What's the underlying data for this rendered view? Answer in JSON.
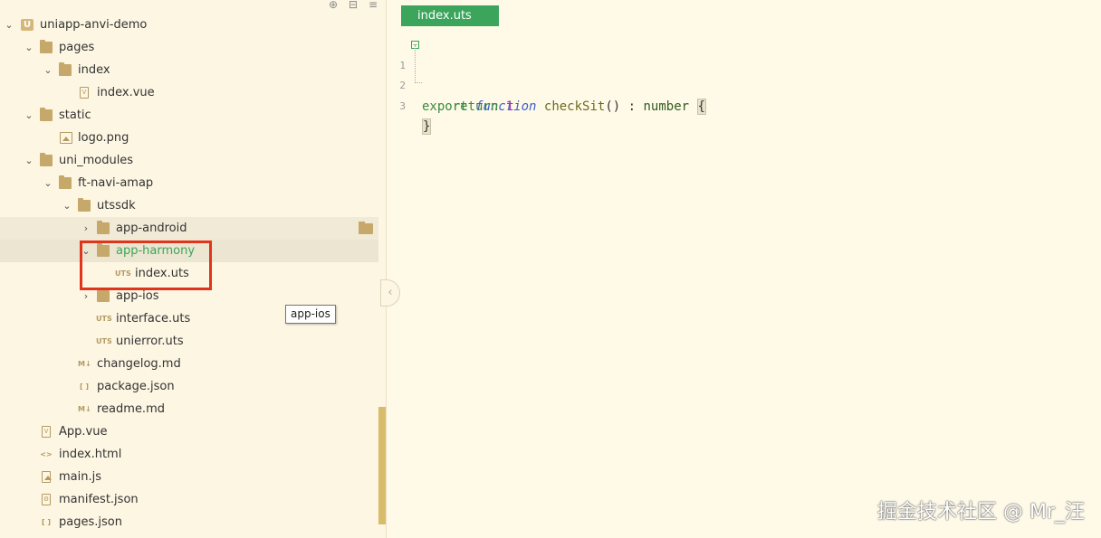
{
  "sidebar": {
    "tree": [
      {
        "label": "uniapp-anvi-demo",
        "icon": "project-icon",
        "expanded": true
      },
      {
        "label": "pages",
        "icon": "folder-icon",
        "expanded": true
      },
      {
        "label": "index",
        "icon": "folder-icon",
        "expanded": true
      },
      {
        "label": "index.vue",
        "icon": "vue-file-icon"
      },
      {
        "label": "static",
        "icon": "folder-icon",
        "expanded": true
      },
      {
        "label": "logo.png",
        "icon": "image-file-icon"
      },
      {
        "label": "uni_modules",
        "icon": "folder-icon",
        "expanded": true
      },
      {
        "label": "ft-navi-amap",
        "icon": "folder-icon",
        "expanded": true
      },
      {
        "label": "utssdk",
        "icon": "folder-icon",
        "expanded": true
      },
      {
        "label": "app-android",
        "icon": "folder-icon",
        "expanded": false
      },
      {
        "label": "app-harmony",
        "icon": "folder-icon",
        "expanded": true
      },
      {
        "label": "index.uts",
        "icon": "uts-file-icon"
      },
      {
        "label": "app-ios",
        "icon": "folder-icon",
        "expanded": false
      },
      {
        "label": "interface.uts",
        "icon": "uts-file-icon"
      },
      {
        "label": "unierror.uts",
        "icon": "uts-file-icon"
      },
      {
        "label": "changelog.md",
        "icon": "markdown-file-icon"
      },
      {
        "label": "package.json",
        "icon": "json-file-icon"
      },
      {
        "label": "readme.md",
        "icon": "markdown-file-icon"
      },
      {
        "label": "App.vue",
        "icon": "vue-file-icon"
      },
      {
        "label": "index.html",
        "icon": "html-file-icon"
      },
      {
        "label": "main.js",
        "icon": "js-file-icon"
      },
      {
        "label": "manifest.json",
        "icon": "manifest-file-icon"
      },
      {
        "label": "pages.json",
        "icon": "json-file-icon"
      }
    ],
    "tooltip": "app-ios",
    "icon_glyphs": {
      "uts": "UTS",
      "md": "M↓",
      "json": "[ ]",
      "html": "<>",
      "vue": "V",
      "project": "U"
    }
  },
  "editor": {
    "active_tab": "index.uts",
    "lines": [
      {
        "num": "1",
        "tokens": {
          "export": "export",
          "function": "function",
          "name": "checkSit",
          "parens": "()",
          "colon": " : ",
          "type": "number",
          "open": "{"
        }
      },
      {
        "num": "2",
        "tokens": {
          "return": "return",
          "value": "1"
        }
      },
      {
        "num": "3",
        "tokens": {
          "close": "}"
        }
      }
    ]
  },
  "watermark": "掘金技术社区 @ Mr_汪",
  "colors": {
    "tab": "#3aa55b",
    "highlight": "#e0341c",
    "background": "#fffae8",
    "sidebar": "#fdf6e3"
  }
}
